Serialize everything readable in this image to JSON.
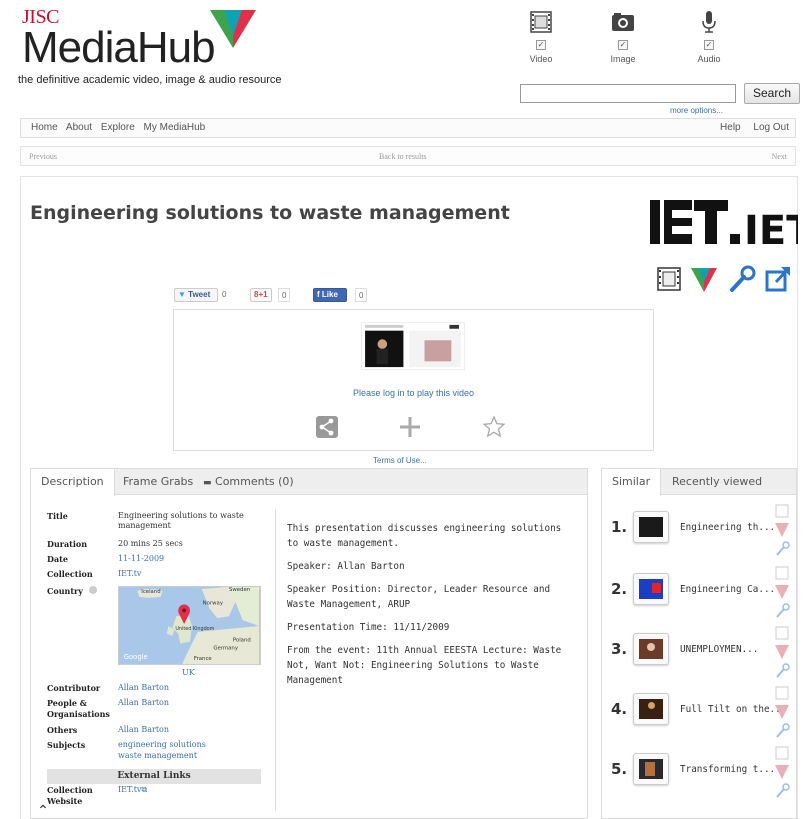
{
  "header": {
    "brand_top": "JISC",
    "brand_main": "MediaHub",
    "tagline": "the definitive academic video, image & audio resource",
    "media_types": [
      {
        "label": "Video",
        "icon": "film-icon",
        "checked": true
      },
      {
        "label": "Image",
        "icon": "camera-icon",
        "checked": true
      },
      {
        "label": "Audio",
        "icon": "microphone-icon",
        "checked": true
      }
    ],
    "search_placeholder": "",
    "search_button": "Search",
    "more_options": "more options..."
  },
  "nav": {
    "left": [
      "Home",
      "About",
      "Explore",
      "My MediaHub"
    ],
    "right": [
      "Help",
      "Log Out"
    ]
  },
  "pager": {
    "previous": "Previous",
    "back": "Back to results",
    "next": "Next"
  },
  "item": {
    "title": "Engineering solutions to waste management",
    "provider_logo_text": "IET.tv"
  },
  "social": {
    "tweet": "Tweet",
    "tweet_count": "0",
    "gplus": "8+1",
    "gplus_count": "0",
    "like": "Like",
    "like_count": "0"
  },
  "player": {
    "login_msg": "Please log in to play this video",
    "terms": "Terms of Use..."
  },
  "left_tabs": [
    {
      "label": "Description",
      "active": true
    },
    {
      "label": "Frame Grabs",
      "active": false
    },
    {
      "label": "Comments (0)",
      "active": false
    }
  ],
  "metadata": {
    "title_k": "Title",
    "title_v": "Engineering solutions to waste management",
    "duration_k": "Duration",
    "duration_v": "20 mins 25 secs",
    "date_k": "Date",
    "date_v": "11-11-2009",
    "collection_k": "Collection",
    "collection_v": "IET.tv",
    "country_k": "Country",
    "country_v": "UK",
    "map_labels": {
      "iceland": "Iceland",
      "norway": "Norway",
      "uk": "United Kingdom",
      "poland": "Poland",
      "germany": "Germany",
      "france": "France",
      "sweden": "Sweden",
      "google": "Google"
    },
    "contributor_k": "Contributor",
    "contributor_v": "Allan Barton",
    "people_k": "People & Organisations",
    "people_v": "Allan Barton",
    "others_k": "Others",
    "others_v": "Allan Barton",
    "subjects_k": "Subjects",
    "subjects_v1": "engineering solutions",
    "subjects_v2": "waste management",
    "external_links": "External Links",
    "collection_website_k": "Collection Website",
    "collection_website_v": "IET.tv"
  },
  "description": {
    "p1": "This presentation discusses engineering solutions to waste management.",
    "p2": "Speaker: Allan Barton",
    "p3": "Speaker Position: Director, Leader Resource and Waste Management, ARUP",
    "p4": "Presentation Time: 11/11/2009",
    "p5": "From the event: 11th Annual  EEESTA Lecture: Waste Not, Want Not: Engineering Solutions to Waste Management"
  },
  "right_tabs": [
    {
      "label": "Similar",
      "active": true
    },
    {
      "label": "Recently viewed",
      "active": false
    }
  ],
  "similar": [
    {
      "num": "1.",
      "title": "Engineering th...",
      "thumb_color": "#1a1a1a"
    },
    {
      "num": "2.",
      "title": "Engineering Ca...",
      "thumb_color": "#1b3fc4"
    },
    {
      "num": "3.",
      "title": "UNEMPLOYMEN...",
      "thumb_color": "#6b3a2a"
    },
    {
      "num": "4.",
      "title": "Full Tilt on the...",
      "thumb_color": "#3a2010"
    },
    {
      "num": "5.",
      "title": "Transforming t...",
      "thumb_color": "#2a2a2a"
    }
  ],
  "colors": {
    "brand_red": "#c8102e",
    "link_blue": "#3a6fb0",
    "tri_green": "#3fa34d",
    "tri_red": "#e0314b",
    "tri_teal": "#0fa3b1"
  }
}
